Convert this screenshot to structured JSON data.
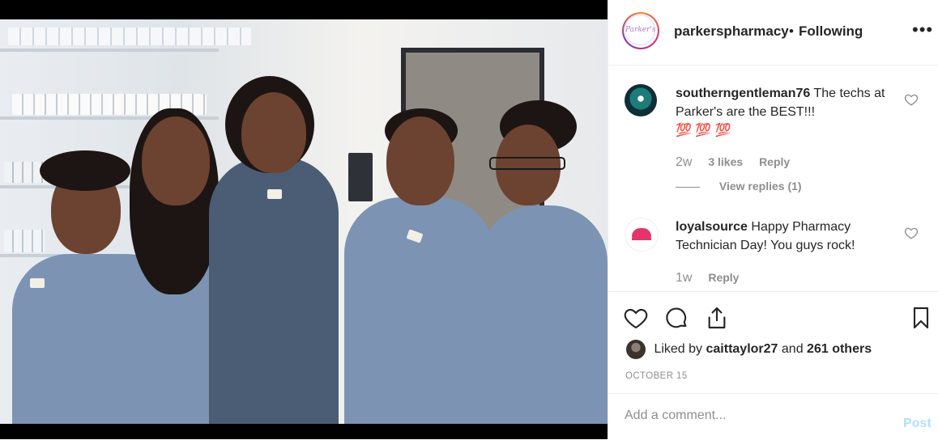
{
  "header": {
    "avatar_text": "Parker's",
    "username": "parkerspharmacy",
    "separator": "•",
    "follow_status": "Following",
    "more_label": "•••"
  },
  "comments": [
    {
      "username": "southerngentleman76",
      "text": "The techs at Parker's are the BEST!!!",
      "emoji": "💯 💯 💯",
      "time": "2w",
      "likes": "3 likes",
      "reply_label": "Reply",
      "view_replies": "View replies (1)"
    },
    {
      "username": "loyalsource",
      "text": "Happy Pharmacy Technician Day! You guys rock!",
      "time": "1w",
      "reply_label": "Reply"
    }
  ],
  "likes": {
    "prefix": "Liked by",
    "user": "caittaylor27",
    "middle": "and",
    "others": "261 others"
  },
  "date": "OCTOBER 15",
  "add_comment": {
    "placeholder": "Add a comment...",
    "post_label": "Post"
  },
  "colors": {
    "post_disabled": "#b2dffc",
    "muted": "#8e8e8e",
    "scrub_blue": "#7c93b3"
  },
  "icons": [
    "heart-icon",
    "comment-icon",
    "share-icon",
    "bookmark-icon",
    "more-icon"
  ]
}
